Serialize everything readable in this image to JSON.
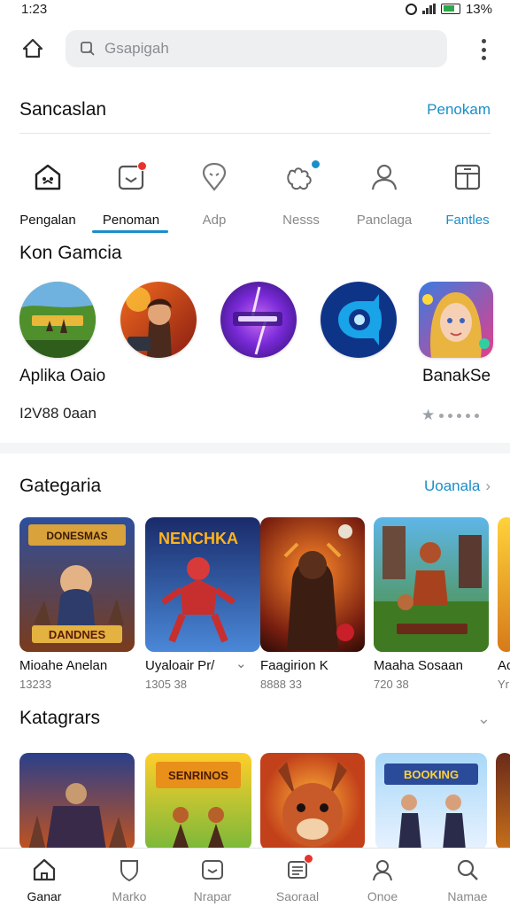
{
  "status_bar": {
    "time": "1:23",
    "battery": "13%"
  },
  "search": {
    "placeholder": "Gsapigah"
  },
  "section_top": {
    "title": "Sancaslan",
    "action": "Penokam"
  },
  "tabs": [
    {
      "label": "Pengalan",
      "icon": "home-icon"
    },
    {
      "label": "Penoman",
      "icon": "notification-icon"
    },
    {
      "label": "Adp",
      "icon": "location-icon"
    },
    {
      "label": "Nesss",
      "icon": "puzzle-icon"
    },
    {
      "label": "Panclaga",
      "icon": "user-icon"
    },
    {
      "label": "Fantles",
      "icon": "grid-icon"
    }
  ],
  "recent": {
    "title": "Kon Gamcia",
    "left_label": "Aplika Oaio",
    "right_label": "BanakSe",
    "count": "I2V88 0aan",
    "apps": [
      {
        "name": "Field",
        "icon": "field-game-icon"
      },
      {
        "name": "Warrior",
        "icon": "warrior-game-icon"
      },
      {
        "name": "Purple",
        "icon": "purple-game-icon"
      },
      {
        "name": "Blue",
        "icon": "blue-game-icon"
      },
      {
        "name": "Girl",
        "icon": "girl-game-icon"
      }
    ]
  },
  "categories": {
    "title": "Gategaria",
    "action": "Uoanala",
    "cards": [
      {
        "name": "Mioahe Anelan",
        "meta": "13233",
        "art_title": "DANDNES",
        "art_head": "DONESMAS"
      },
      {
        "name": "Uyaloair Pr/",
        "meta": "1305 38",
        "art_title": "NENCHKA",
        "art_head": ""
      },
      {
        "name": "Faagirion K",
        "meta": "8888 33",
        "art_title": "",
        "art_head": ""
      },
      {
        "name": "Maaha Sosaan",
        "meta": "720 38",
        "art_title": "",
        "art_head": ""
      },
      {
        "name": "Ac",
        "meta": "Yr",
        "art_title": "",
        "art_head": ""
      }
    ]
  },
  "categories2": {
    "title": "Katagrars",
    "cards": [
      {
        "art_title": ""
      },
      {
        "art_title": "SENRINOS"
      },
      {
        "art_title": ""
      },
      {
        "art_title": "BOOKING"
      },
      {
        "art_title": ""
      }
    ]
  },
  "bottom_nav": [
    {
      "label": "Ganar",
      "icon": "home-icon"
    },
    {
      "label": "Marko",
      "icon": "shield-icon"
    },
    {
      "label": "Nrapar",
      "icon": "inbox-icon"
    },
    {
      "label": "Saoraal",
      "icon": "chat-icon"
    },
    {
      "label": "Onoe",
      "icon": "person-icon"
    },
    {
      "label": "Namae",
      "icon": "search-icon"
    }
  ],
  "colors": {
    "accent": "#1a8ec8",
    "badge": "#e8332c",
    "search_bg": "#eeeff1"
  }
}
